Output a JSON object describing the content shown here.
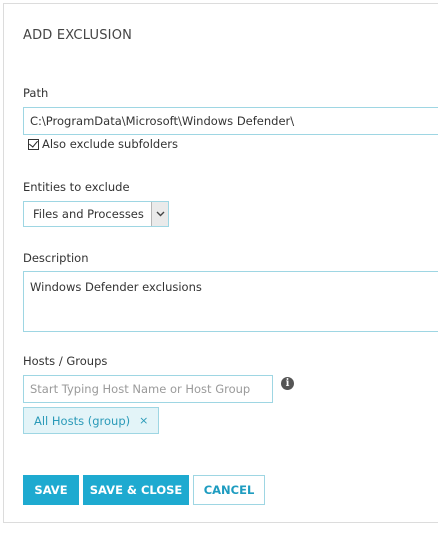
{
  "dialog": {
    "title": "ADD EXCLUSION"
  },
  "path": {
    "label": "Path",
    "value": "C:\\ProgramData\\Microsoft\\Windows Defender\\",
    "subfolders_label": "Also exclude subfolders",
    "subfolders_checked": true
  },
  "entities": {
    "label": "Entities to exclude",
    "selected": "Files and Processes"
  },
  "description": {
    "label": "Description",
    "value": "Windows Defender exclusions"
  },
  "hosts": {
    "label": "Hosts / Groups",
    "placeholder": "Start Typing Host Name or Host Group",
    "info_icon": "info-icon",
    "tags": [
      "All Hosts (group)"
    ],
    "tag_remove_glyph": "×"
  },
  "buttons": {
    "save": "SAVE",
    "save_close": "SAVE & CLOSE",
    "cancel": "CANCEL"
  },
  "colors": {
    "accent": "#1eaad0",
    "border": "#9ed6e3",
    "tag_bg": "#e3f4f8"
  }
}
